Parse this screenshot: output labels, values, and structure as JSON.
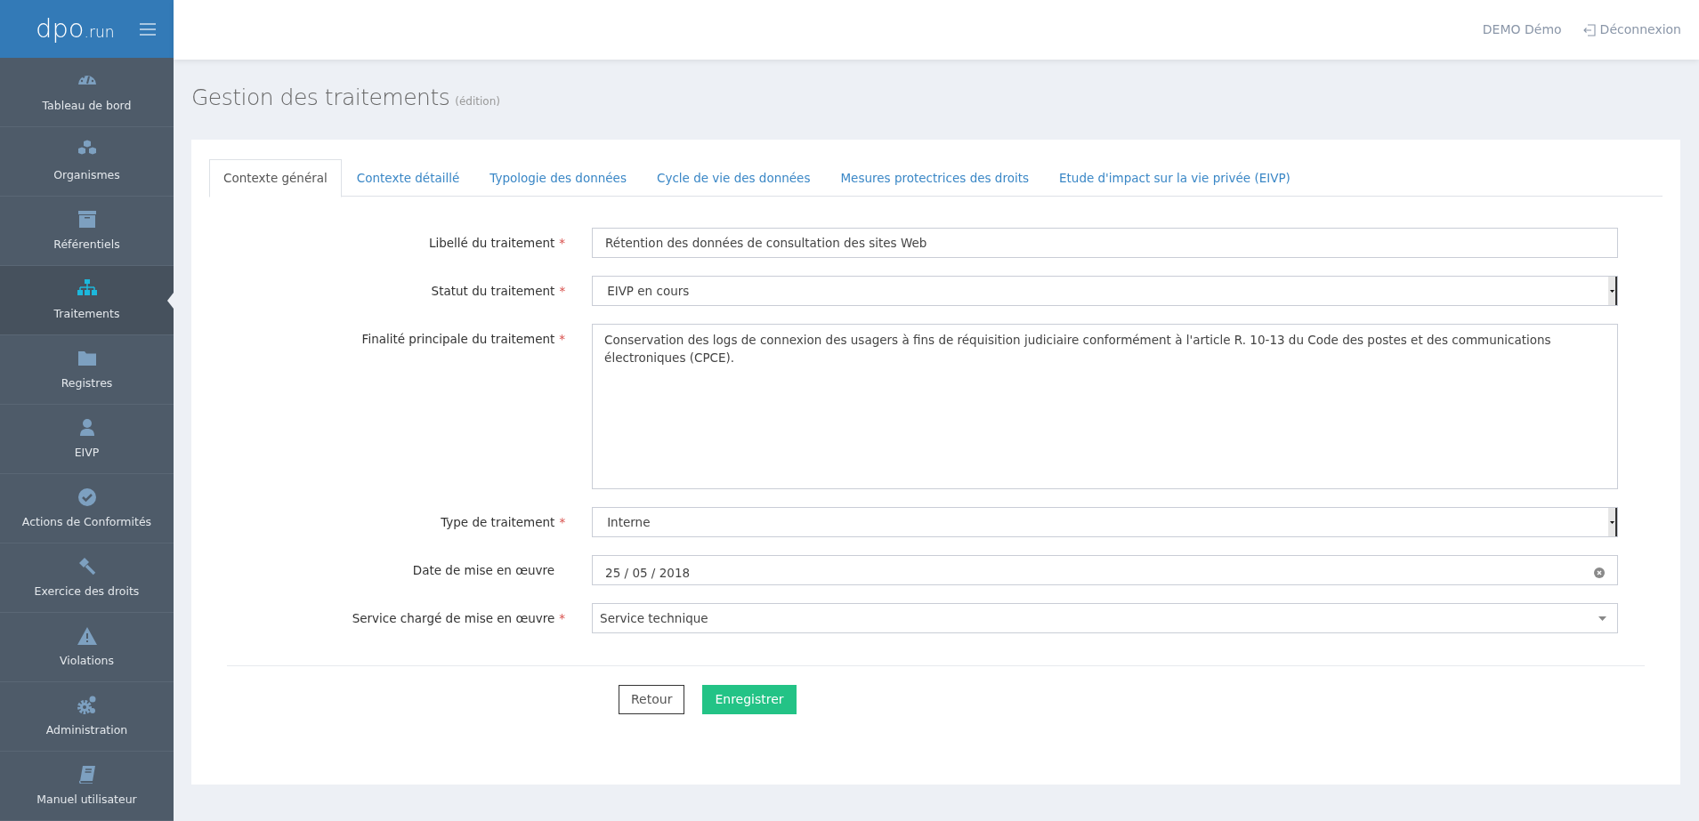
{
  "logo": {
    "main": "dpo",
    "suffix": ".run"
  },
  "header": {
    "user": "DEMO Démo",
    "logout": "Déconnexion"
  },
  "sidebar": {
    "items": [
      {
        "label": "Tableau de bord",
        "selected": false
      },
      {
        "label": "Organismes",
        "selected": false
      },
      {
        "label": "Référentiels",
        "selected": false
      },
      {
        "label": "Traitements",
        "selected": true
      },
      {
        "label": "Registres",
        "selected": false
      },
      {
        "label": "EIVP",
        "selected": false
      },
      {
        "label": "Actions de Conformités",
        "selected": false
      },
      {
        "label": "Exercice des droits",
        "selected": false
      },
      {
        "label": "Violations",
        "selected": false
      },
      {
        "label": "Administration",
        "selected": false
      },
      {
        "label": "Manuel utilisateur",
        "selected": false
      }
    ]
  },
  "page": {
    "title": "Gestion des traitements",
    "subtitle": "(édition)"
  },
  "tabs": [
    {
      "label": "Contexte général",
      "selected": true
    },
    {
      "label": "Contexte détaillé",
      "selected": false
    },
    {
      "label": "Typologie des données",
      "selected": false
    },
    {
      "label": "Cycle de vie des données",
      "selected": false
    },
    {
      "label": "Mesures protectrices des droits",
      "selected": false
    },
    {
      "label": "Etude d'impact sur la vie privée (EIVP)",
      "selected": false
    }
  ],
  "form": {
    "fields": [
      {
        "kind": "text",
        "label": "Libellé du traitement",
        "required_mark": "*",
        "value": "Rétention des données de consultation des sites Web"
      },
      {
        "kind": "select",
        "label": "Statut du traitement",
        "required_mark": "*",
        "value": "EIVP en cours"
      },
      {
        "kind": "textarea",
        "label": "Finalité principale du traitement",
        "required_mark": "*",
        "value": "Conservation des logs de connexion des usagers à fins de réquisition judiciaire conformément à l'article R. 10-13 du Code des postes et des communications électroniques (CPCE)."
      },
      {
        "kind": "select",
        "label": "Type de traitement",
        "required_mark": "*",
        "value": "Interne"
      },
      {
        "kind": "date",
        "label": "Date de mise en œuvre",
        "value": "25 / 05 / 2018"
      },
      {
        "kind": "combo",
        "label": "Service chargé de mise en œuvre",
        "required_mark": "*",
        "value": "Service technique"
      }
    ],
    "buttons": [
      {
        "kind": "secondary",
        "label": "Retour"
      },
      {
        "kind": "primary",
        "label": "Enregistrer"
      }
    ]
  }
}
